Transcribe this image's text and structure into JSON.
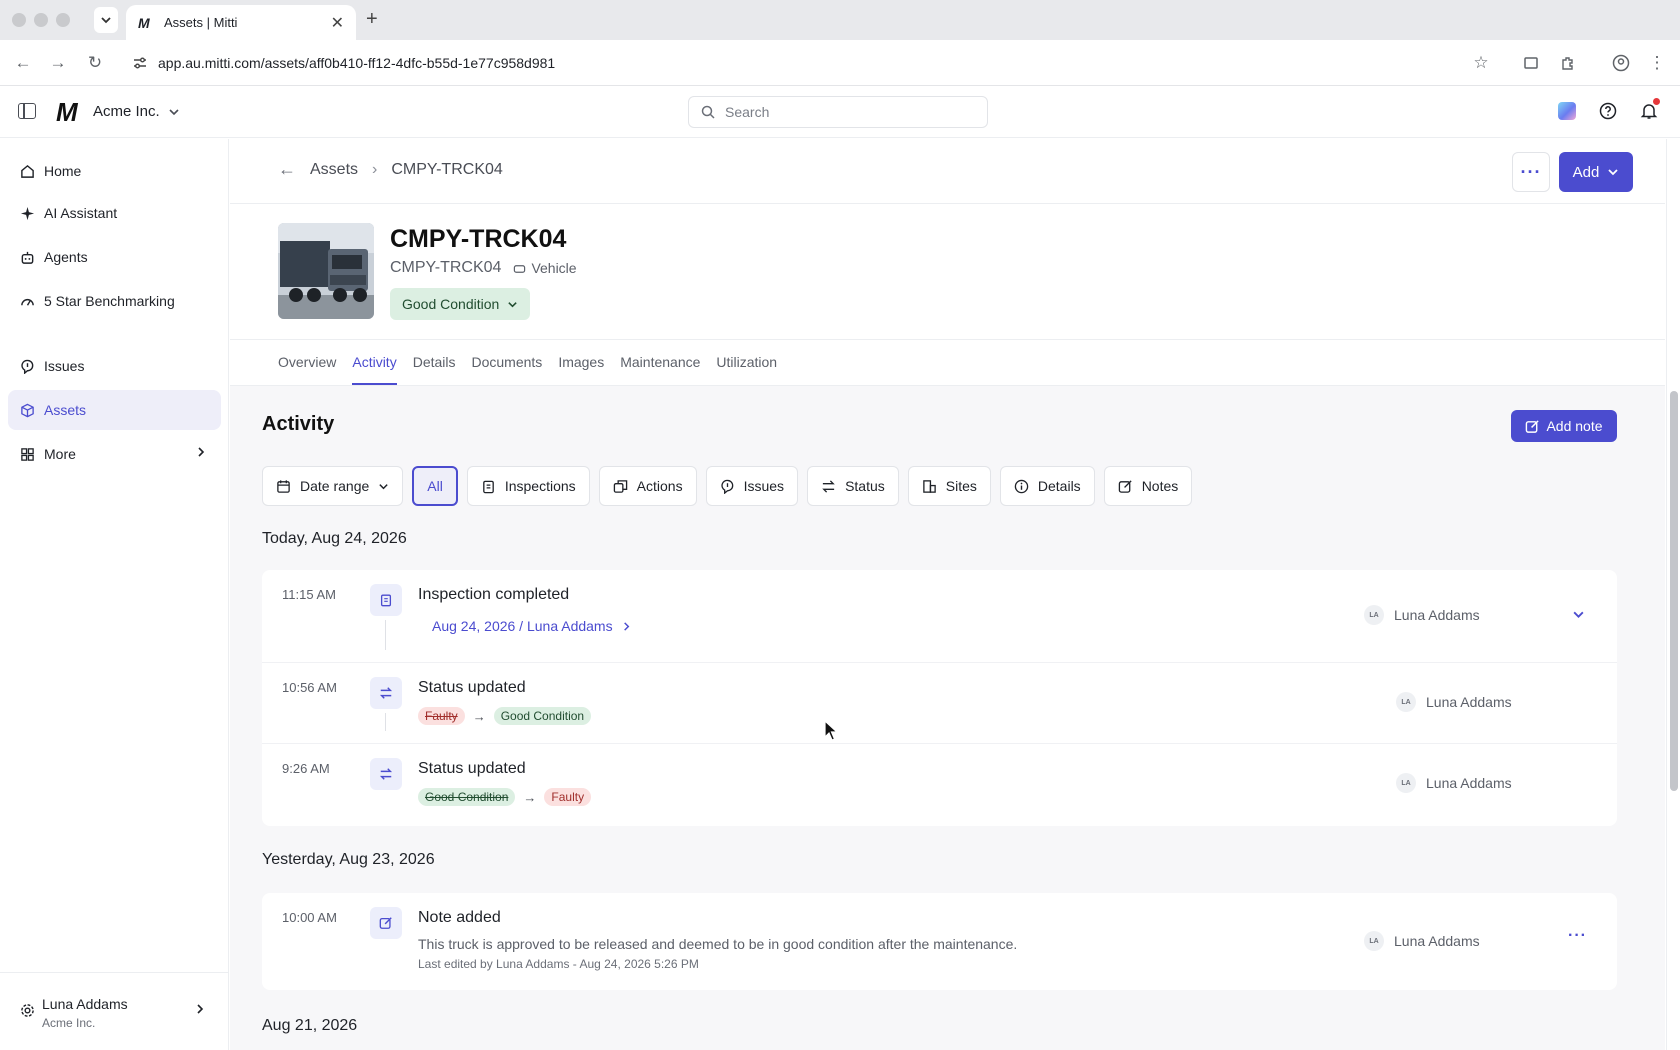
{
  "browser": {
    "tab_title": "Assets | Mitti",
    "tab_favicon": "M",
    "url": "app.au.mitti.com/assets/aff0b410-ff12-4dfc-b55d-1e77c958d981"
  },
  "header": {
    "logo": "M",
    "org_name": "Acme Inc.",
    "search_placeholder": "Search"
  },
  "sidebar": {
    "items": [
      {
        "label": "Home",
        "icon": "home-icon"
      },
      {
        "label": "AI Assistant",
        "icon": "sparkle-icon"
      },
      {
        "label": "Agents",
        "icon": "robot-icon"
      },
      {
        "label": "5 Star Benchmarking",
        "icon": "gauge-icon"
      },
      {
        "label": "Issues",
        "icon": "issue-icon"
      },
      {
        "label": "Assets",
        "icon": "cube-icon",
        "active": true
      },
      {
        "label": "More",
        "icon": "grid-icon"
      }
    ],
    "user": {
      "name": "Luna Addams",
      "org": "Acme Inc."
    }
  },
  "breadcrumb": {
    "parent": "Assets",
    "current": "CMPY-TRCK04"
  },
  "actions": {
    "more": "···",
    "add": "Add",
    "add_note": "Add note"
  },
  "asset": {
    "title": "CMPY-TRCK04",
    "code": "CMPY-TRCK04",
    "type": "Vehicle",
    "condition": "Good Condition"
  },
  "tabs": [
    "Overview",
    "Activity",
    "Details",
    "Documents",
    "Images",
    "Maintenance",
    "Utilization"
  ],
  "activity": {
    "title": "Activity",
    "filters": [
      {
        "label": "Date range",
        "icon": "calendar-icon"
      },
      {
        "label": "All"
      },
      {
        "label": "Inspections",
        "icon": "clipboard-icon"
      },
      {
        "label": "Actions",
        "icon": "actions-icon"
      },
      {
        "label": "Issues",
        "icon": "issue-icon"
      },
      {
        "label": "Status",
        "icon": "swap-icon"
      },
      {
        "label": "Sites",
        "icon": "building-icon"
      },
      {
        "label": "Details",
        "icon": "info-icon"
      },
      {
        "label": "Notes",
        "icon": "edit-icon"
      }
    ],
    "groups": [
      {
        "date": "Today, Aug 24, 2026",
        "entries": [
          {
            "time": "11:15 AM",
            "title": "Inspection completed",
            "link": "Aug 24, 2026 / Luna Addams",
            "user": "Luna Addams",
            "initials": "LA"
          },
          {
            "time": "10:56 AM",
            "title": "Status updated",
            "from": "Faulty",
            "to": "Good Condition",
            "user": "Luna Addams",
            "initials": "LA"
          },
          {
            "time": "9:26 AM",
            "title": "Status updated",
            "from": "Good Condition",
            "to": "Faulty",
            "user": "Luna Addams",
            "initials": "LA"
          }
        ]
      },
      {
        "date": "Yesterday, Aug 23, 2026",
        "entries": [
          {
            "time": "10:00 AM",
            "title": "Note added",
            "body": "This truck is approved to be released and deemed to be in good condition after the maintenance.",
            "meta": "Last edited by Luna Addams - Aug 24, 2026 5:26 PM",
            "user": "Luna Addams",
            "initials": "LA"
          }
        ]
      },
      {
        "date": "Aug 21, 2026",
        "entries": []
      }
    ]
  },
  "colors": {
    "accent": "#4b4ccf",
    "good": "#dcefe2",
    "faulty": "#fbe0df"
  }
}
